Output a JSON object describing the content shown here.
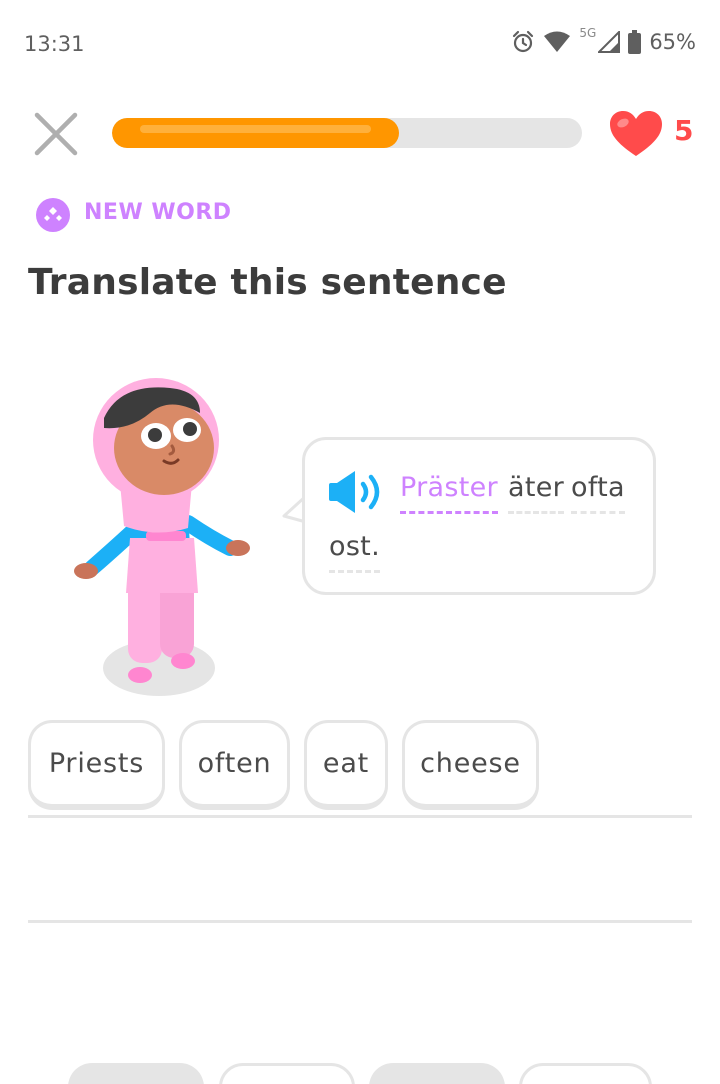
{
  "status_bar": {
    "time": "13:31",
    "network": "5G",
    "battery": "65%",
    "icons": [
      "alarm-icon",
      "wifi-icon",
      "cell-signal-icon",
      "battery-icon"
    ]
  },
  "header": {
    "progress": 0.61,
    "hearts": "5",
    "colors": {
      "progress": "#ff9600",
      "heart": "#ff4b4b"
    }
  },
  "badge": {
    "label": "NEW WORD",
    "color": "#ce82ff"
  },
  "title": "Translate this sentence",
  "bubble": {
    "words": [
      {
        "text": "Präster",
        "is_new": true
      },
      {
        "text": "äter",
        "is_new": false
      },
      {
        "text": "ofta",
        "is_new": false
      },
      {
        "text": "ost.",
        "is_new": false
      }
    ]
  },
  "answer": {
    "chips": [
      "Priests",
      "often",
      "eat",
      "cheese"
    ]
  },
  "word_bank": {
    "slots": [
      "used",
      "available",
      "used",
      "available"
    ]
  }
}
